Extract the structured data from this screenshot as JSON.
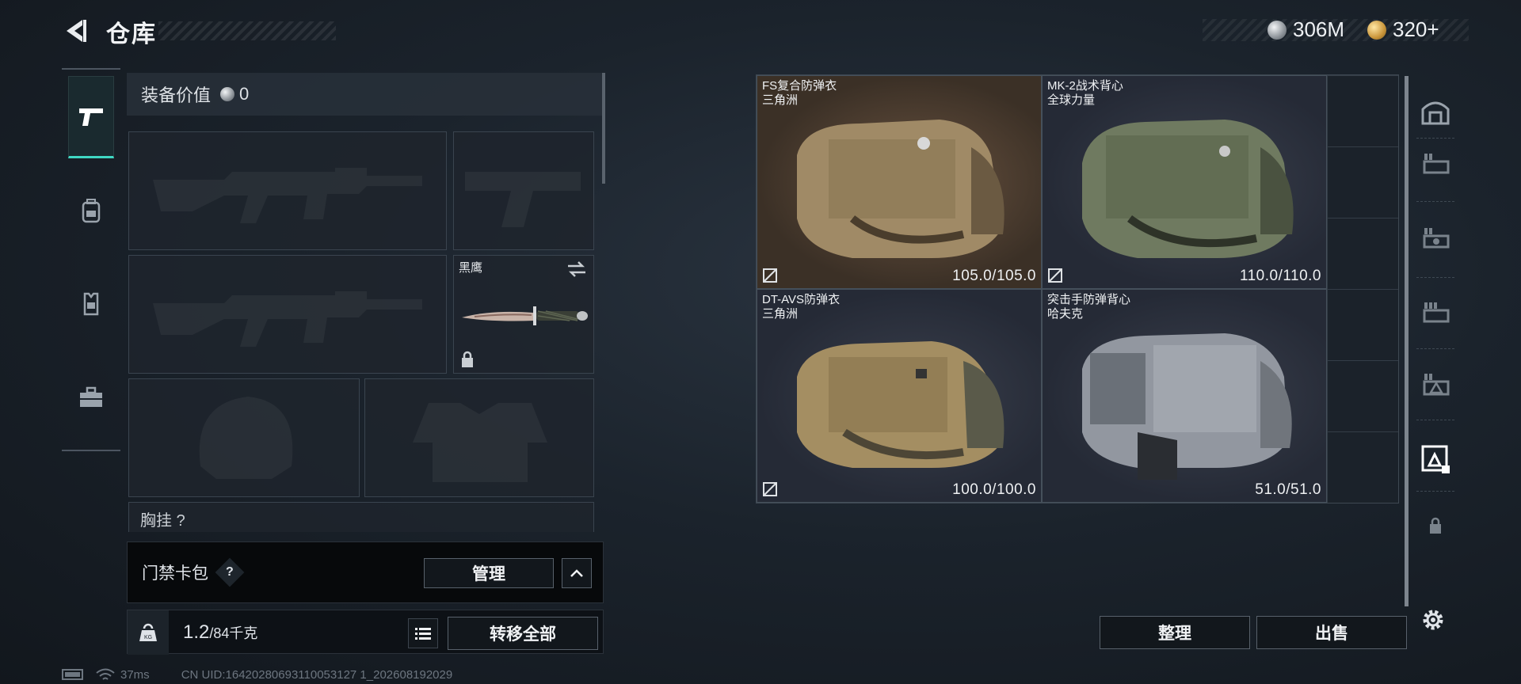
{
  "header": {
    "title": "仓库",
    "currencies": [
      {
        "icon": "silver-coin-icon",
        "value": "306M"
      },
      {
        "icon": "gold-coin-icon",
        "value": "320+"
      }
    ]
  },
  "left_tabs": [
    {
      "icon": "pistol-icon",
      "active": true
    },
    {
      "icon": "backpack-icon",
      "active": false
    },
    {
      "icon": "vest-icon",
      "active": false
    },
    {
      "icon": "toolbox-icon",
      "active": false
    }
  ],
  "equipment": {
    "value_label": "装备价值",
    "value_amount": "0",
    "melee_slot_name": "黑鹰",
    "chest_rig_label": "胸挂",
    "chest_rig_count": "?"
  },
  "card_bag": {
    "label": "门禁卡包",
    "help": "?",
    "manage_label": "管理"
  },
  "weight": {
    "current": "1.2",
    "max_unit": "/84千克",
    "transfer_all_label": "转移全部"
  },
  "items": [
    {
      "name": "FS复合防弹衣",
      "brand": "三角洲",
      "durability": "105.0/105.0",
      "color": "tan"
    },
    {
      "name": "MK-2战术背心",
      "brand": "全球力量",
      "durability": "110.0/110.0",
      "color": "green"
    },
    {
      "name": "DT-AVS防弹衣",
      "brand": "三角洲",
      "durability": "100.0/100.0",
      "color": "coyote"
    },
    {
      "name": "突击手防弹背心",
      "brand": "哈夫克",
      "durability": "51.0/51.0",
      "color": "grey"
    }
  ],
  "actions": {
    "sort_label": "整理",
    "sell_label": "出售"
  },
  "status_bar": {
    "ping": "37ms",
    "uid": "CN UID:16420280693110053127 1_202608192029"
  },
  "colors": {
    "accent": "#3fd8c3",
    "panel": "#1b222a",
    "border": "#3e4852"
  }
}
